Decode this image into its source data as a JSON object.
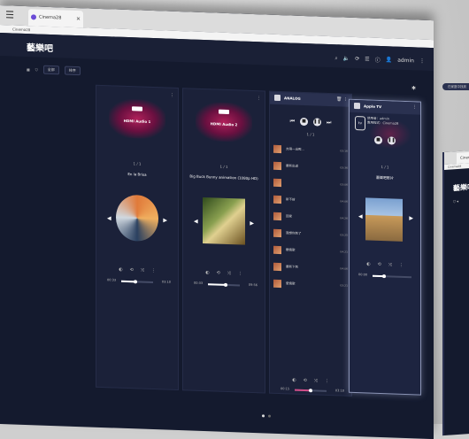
{
  "browser": {
    "tab_title": "Cinema28",
    "url": "Cinema28"
  },
  "app": {
    "title": "藝樂吧",
    "user": "admin",
    "filters": {
      "group_label": "全部",
      "sort_label": "排序"
    }
  },
  "cards": [
    {
      "name": "HDMI Audio 1",
      "badge": "HDMI",
      "track_count": "1 / 1",
      "track_title": "En la Brisa",
      "time_start": "00:33",
      "time_end": "03:10",
      "progress": 0.45
    },
    {
      "name": "HDMI Audio 2",
      "badge": "HDMI",
      "track_count": "1 / 1",
      "track_title": "Big Buck Bunny animation (1080p HD)",
      "time_start": "00:33",
      "time_end": "09:56",
      "progress": 0.55
    },
    {
      "name": "ANALOG",
      "track_count": "1 / 1",
      "time_start": "00:15",
      "time_end": "03:10",
      "progress": 0.5,
      "playlist": [
        {
          "title": "太陽一出照...",
          "duration": "03:16"
        },
        {
          "title": "最新出道",
          "duration": "03:36"
        },
        {
          "title": "",
          "duration": "03:06"
        },
        {
          "title": "新不捨",
          "duration": "04:06"
        },
        {
          "title": "回家",
          "duration": "04:26"
        },
        {
          "title": "我想你到了",
          "duration": "03:25"
        },
        {
          "title": "聽情歌",
          "duration": "04:21"
        },
        {
          "title": "最新下到",
          "duration": "04:06"
        },
        {
          "title": "愛情歌",
          "duration": "03:21"
        }
      ]
    },
    {
      "name": "Apple TV",
      "device_user": "使用者：admin",
      "device_app": "應用程式：Cinema28",
      "track_count": "1 / 1",
      "track_title": "藝樂吧影片",
      "time_start": "00:00",
      "progress": 0.3
    }
  ],
  "second_window": {
    "tab_title": "Cinema28",
    "title": "藝樂吧"
  },
  "side_pill": "在家庭中找到",
  "icons": {
    "menu": "menu-icon",
    "search": "search-icon",
    "bluetooth": "bluetooth-icon",
    "more": "more-vertical-icon"
  }
}
